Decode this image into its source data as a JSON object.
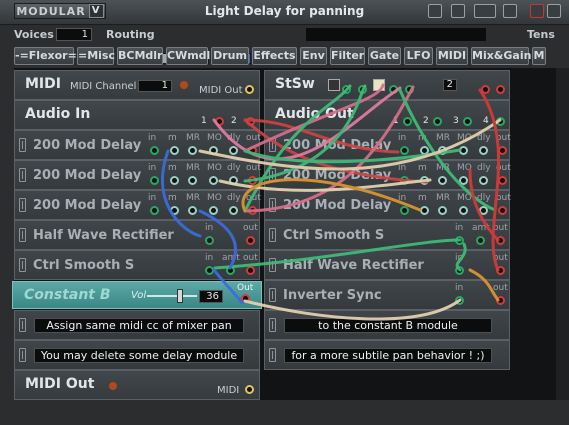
{
  "window": {
    "title": "Light Delay for panning",
    "logo_text": "MODULAR",
    "logo_mark": "V"
  },
  "toolbar": {
    "voices_label": "Voices",
    "voices_value": "1",
    "routing_label": "Routing",
    "routing_swatches": [
      {
        "color": "#a7a7a7",
        "label": ""
      },
      {
        "color": "#000000",
        "label": "S"
      },
      {
        "color": "#e03a2c",
        "label": ""
      },
      {
        "color": "#f2a51c",
        "label": ""
      },
      {
        "color": "#e8de1c",
        "label": ""
      },
      {
        "color": "#38c24a",
        "label": ""
      },
      {
        "color": "#2f6fe0",
        "label": ""
      },
      {
        "color": "#b13fd9",
        "label": ""
      },
      {
        "color": "#9a9a9a",
        "label": "M"
      }
    ],
    "tens_label": "Tens"
  },
  "menu": [
    "-=Flexor=-",
    "=Misc",
    "BCMdlr",
    "CWmdl",
    "Drum",
    "Effects",
    "Env",
    "Filter",
    "Gate",
    "LFO",
    "MIDI",
    "Mix&Gain",
    "M"
  ],
  "left_column": {
    "midi": {
      "name": "MIDI",
      "channel_label": "MIDI Channel",
      "channel_value": "1",
      "out_label": "MIDI Out"
    },
    "audio_in": {
      "name": "Audio In",
      "port1": "1",
      "port2": "2"
    },
    "delays": [
      {
        "name": "200 Mod Delay",
        "ports": [
          "in",
          "m",
          "MR",
          "MO",
          "dly",
          "out"
        ]
      },
      {
        "name": "200 Mod Delay",
        "ports": [
          "in",
          "m",
          "MR",
          "MO",
          "dly",
          "out"
        ]
      },
      {
        "name": "200 Mod Delay",
        "ports": [
          "in",
          "m",
          "MR",
          "MO",
          "dly",
          "out"
        ]
      }
    ],
    "half_wave": {
      "name": "Half Wave Rectifier",
      "in": "in",
      "out": "out"
    },
    "ctrl_smooth": {
      "name": "Ctrl Smooth S",
      "in": "in",
      "amt": "amt",
      "out": "out"
    },
    "constant_b": {
      "name": "Constant B",
      "vol_label": "Vol",
      "value": "36",
      "out": "Out",
      "level": 0.66
    },
    "note1": "Assign same midi cc of mixer pan",
    "note2": "You may delete some delay module",
    "midi_out": {
      "name": "MIDI Out",
      "port_label": "MIDI"
    }
  },
  "right_column": {
    "stsw": {
      "name": "StSw",
      "value": "2"
    },
    "audio_out": {
      "name": "Audio Out",
      "ports": [
        "1",
        "2",
        "3",
        "4"
      ]
    },
    "delays": [
      {
        "name": "200 Mod Delay",
        "ports": [
          "in",
          "m",
          "MR",
          "MO",
          "dly",
          "out"
        ]
      },
      {
        "name": "200 Mod Delay",
        "ports": [
          "in",
          "m",
          "MR",
          "MO",
          "dly",
          "out"
        ]
      },
      {
        "name": "200 Mod Delay",
        "ports": [
          "in",
          "m",
          "MR",
          "MO",
          "dly",
          "out"
        ]
      }
    ],
    "ctrl_smooth": {
      "name": "Ctrl Smooth S",
      "in": "in",
      "amt": "amt",
      "out": "out"
    },
    "half_wave": {
      "name": "Half Wave Rectifier",
      "in": "in",
      "out": "out"
    },
    "inverter": {
      "name": "Inverter Sync",
      "in": "in",
      "out": "out"
    },
    "note1": "to the constant B module",
    "note2": "for a more subtile pan behavior ! ;)"
  }
}
